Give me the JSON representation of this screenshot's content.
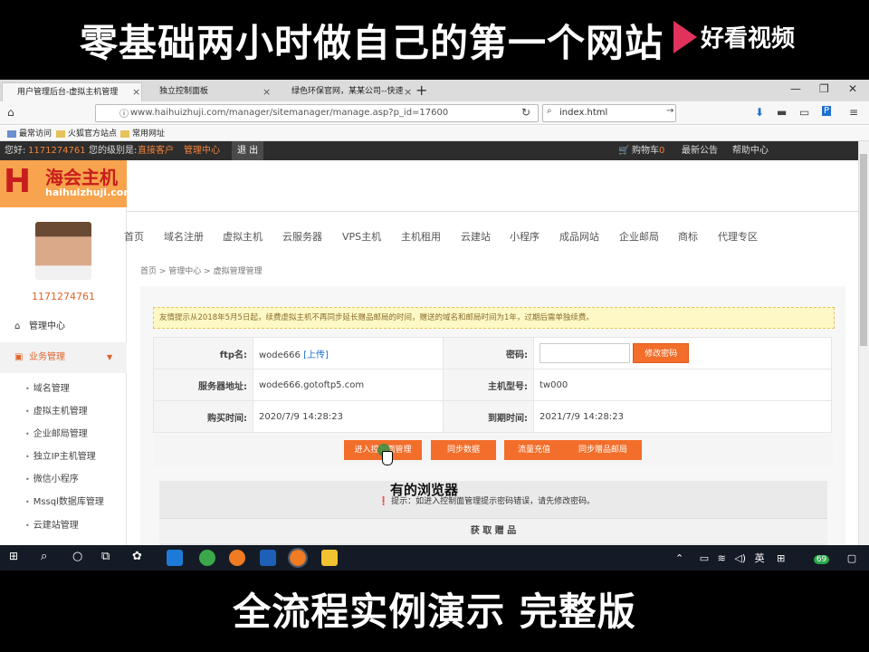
{
  "overlay": {
    "title": "零基础两小时做自己的第一个网站",
    "brand": "好看视频",
    "subtitle": "全流程实例演示 完整版",
    "mid_caption": "有的浏览器"
  },
  "browser": {
    "tabs": [
      {
        "label": "用户管理后台-虚拟主机管理",
        "active": true
      },
      {
        "label": "独立控制面板",
        "active": false
      },
      {
        "label": "绿色环保官网，某某公司--快速...",
        "active": false
      }
    ],
    "url": "www.haihuizhuji.com/manager/sitemanager/manage.asp?p_id=17600",
    "search_value": "index.html",
    "bookmarks": [
      "最常访问",
      "火狐官方站点",
      "常用网址"
    ]
  },
  "topbar": {
    "greeting": "您好:",
    "user_id": "1171274761",
    "level_label": "您的级别是:",
    "level_value": "直接客户",
    "manage_center": "管理中心",
    "logout": "退 出",
    "cart": "购物车",
    "cart_count": "0",
    "announcement": "最新公告",
    "help": "帮助中心"
  },
  "site": {
    "logo_cn": "海会主机",
    "logo_en": "haihuizhuji.com",
    "username": "1171274761"
  },
  "sidebar": {
    "menu": [
      "管理中心",
      "业务管理"
    ],
    "subitems": [
      "域名管理",
      "虚拟主机管理",
      "企业邮局管理",
      "独立IP主机管理",
      "微信小程序",
      "Mssql数据库管理",
      "云建站管理"
    ]
  },
  "mainnav": [
    "首页",
    "域名注册",
    "虚拟主机",
    "云服务器",
    "VPS主机",
    "主机租用",
    "云建站",
    "小程序",
    "成品网站",
    "企业邮局",
    "商标",
    "代理专区"
  ],
  "breadcrumb": [
    "首页",
    "管理中心",
    "虚拟管理管理"
  ],
  "notice": "友情提示从2018年5月5日起，续费虚拟主机不再同步延长赠品邮局的时间，赠送的域名和邮局时间为1年，过期后需单独续费。",
  "info": {
    "ftp_label": "ftp名:",
    "ftp_value": "wode666",
    "upload": "[上传]",
    "pwd_label": "密码:",
    "pwd_button": "修改密码",
    "server_label": "服务器地址:",
    "server_value": "wode666.gotoftp5.com",
    "model_label": "主机型号:",
    "model_value": "tw000",
    "buy_label": "购买时间:",
    "buy_value": "2020/7/9 14:28:23",
    "expire_label": "到期时间:",
    "expire_value": "2021/7/9 14:28:23"
  },
  "actions": [
    "进入控制面管理",
    "同步数据",
    "流量充值",
    "同步赠品邮局"
  ],
  "warning": "提示：如进入控制面管理提示密码错误，请先修改密码。",
  "gift": "获 取 赠 品",
  "taskbar": {
    "ime": "英",
    "badge": "69"
  }
}
